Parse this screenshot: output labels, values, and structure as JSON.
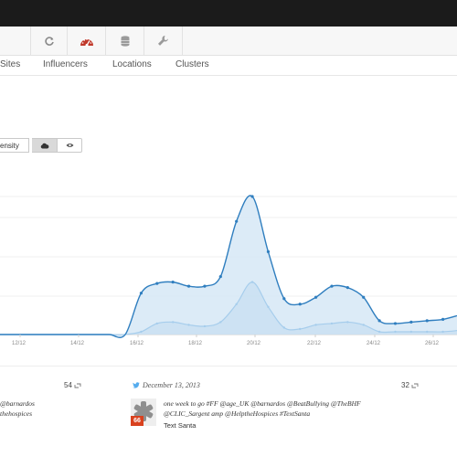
{
  "toolbar": {
    "icons": [
      "refresh-icon",
      "dashboard-gauge-icon",
      "database-icon",
      "wrench-icon"
    ],
    "accent": "#c0392b"
  },
  "tabs": [
    {
      "label": "Sites"
    },
    {
      "label": "Influencers"
    },
    {
      "label": "Locations"
    },
    {
      "label": "Clusters"
    }
  ],
  "view_toggle": {
    "density_label": "ensity",
    "cloud_icon": "cloud-icon",
    "eye_icon": "eye-icon"
  },
  "chart_data": {
    "type": "area",
    "title": "",
    "xlabel": "",
    "ylabel": "",
    "categories": [
      "12/12",
      "14/12",
      "16/12",
      "18/12",
      "20/12",
      "22/12",
      "24/12",
      "26/12"
    ],
    "series": [
      {
        "values": [
          0,
          0,
          0,
          0,
          0,
          0,
          0,
          0,
          0,
          0.3,
          0.37,
          0.38,
          0.35,
          0.35,
          0.42,
          0.82,
          1.0,
          0.6,
          0.26,
          0.22,
          0.27,
          0.35,
          0.34,
          0.27,
          0.1,
          0.08,
          0.09,
          0.1,
          0.11,
          0.14
        ]
      },
      {
        "values": [
          0,
          0,
          0,
          0,
          0,
          0,
          0,
          0,
          0,
          0.02,
          0.08,
          0.09,
          0.07,
          0.06,
          0.09,
          0.22,
          0.38,
          0.2,
          0.05,
          0.04,
          0.07,
          0.08,
          0.09,
          0.07,
          0.02,
          0.02,
          0.02,
          0.02,
          0.02,
          0.03
        ]
      }
    ],
    "grid": true,
    "colors": {
      "line": "#2f7ebf",
      "fill": "#d6e8f6",
      "secondary_line": "#a6cdec"
    }
  },
  "feed": {
    "left": {
      "count": "54",
      "lines": [
        "@barnardos",
        "thehospices"
      ]
    },
    "right": {
      "source_icon": "twitter-icon",
      "date": "December 13, 2013",
      "count": "32",
      "lines": [
        "one week to go #FF @age_UK @barnardos @BeatBullying @TheBHF",
        "@CLIC_Sargent amp @HelptheHospices #TextSanta"
      ],
      "author": "Text Santa",
      "badge": "66"
    },
    "retweet_icon": "retweet-icon"
  }
}
